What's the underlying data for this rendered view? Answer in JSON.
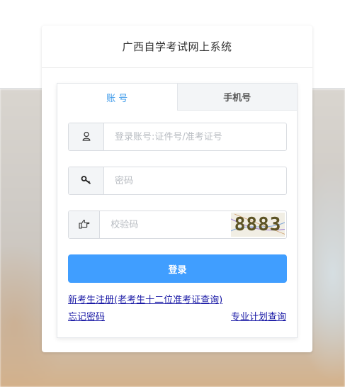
{
  "header": {
    "title": "广西自学考试网上系统"
  },
  "tabs": [
    {
      "label": "账 号",
      "active": true
    },
    {
      "label": "手机号",
      "active": false
    }
  ],
  "form": {
    "account_placeholder": "登录账号:证件号/准考证号",
    "password_placeholder": "密码",
    "captcha_placeholder": "校验码",
    "captcha_code": "8883",
    "login_label": "登录"
  },
  "links": {
    "register": "新考生注册(老考生十二位准考证查询)",
    "forgot": "忘记密码",
    "plan": "专业计划查询"
  },
  "colors": {
    "accent": "#409eff",
    "tab_active": "#3f9bea",
    "link": "#1a1aa6"
  },
  "icons": {
    "account": "user-icon",
    "password": "key-icon",
    "captcha": "hand-pointer-icon"
  }
}
